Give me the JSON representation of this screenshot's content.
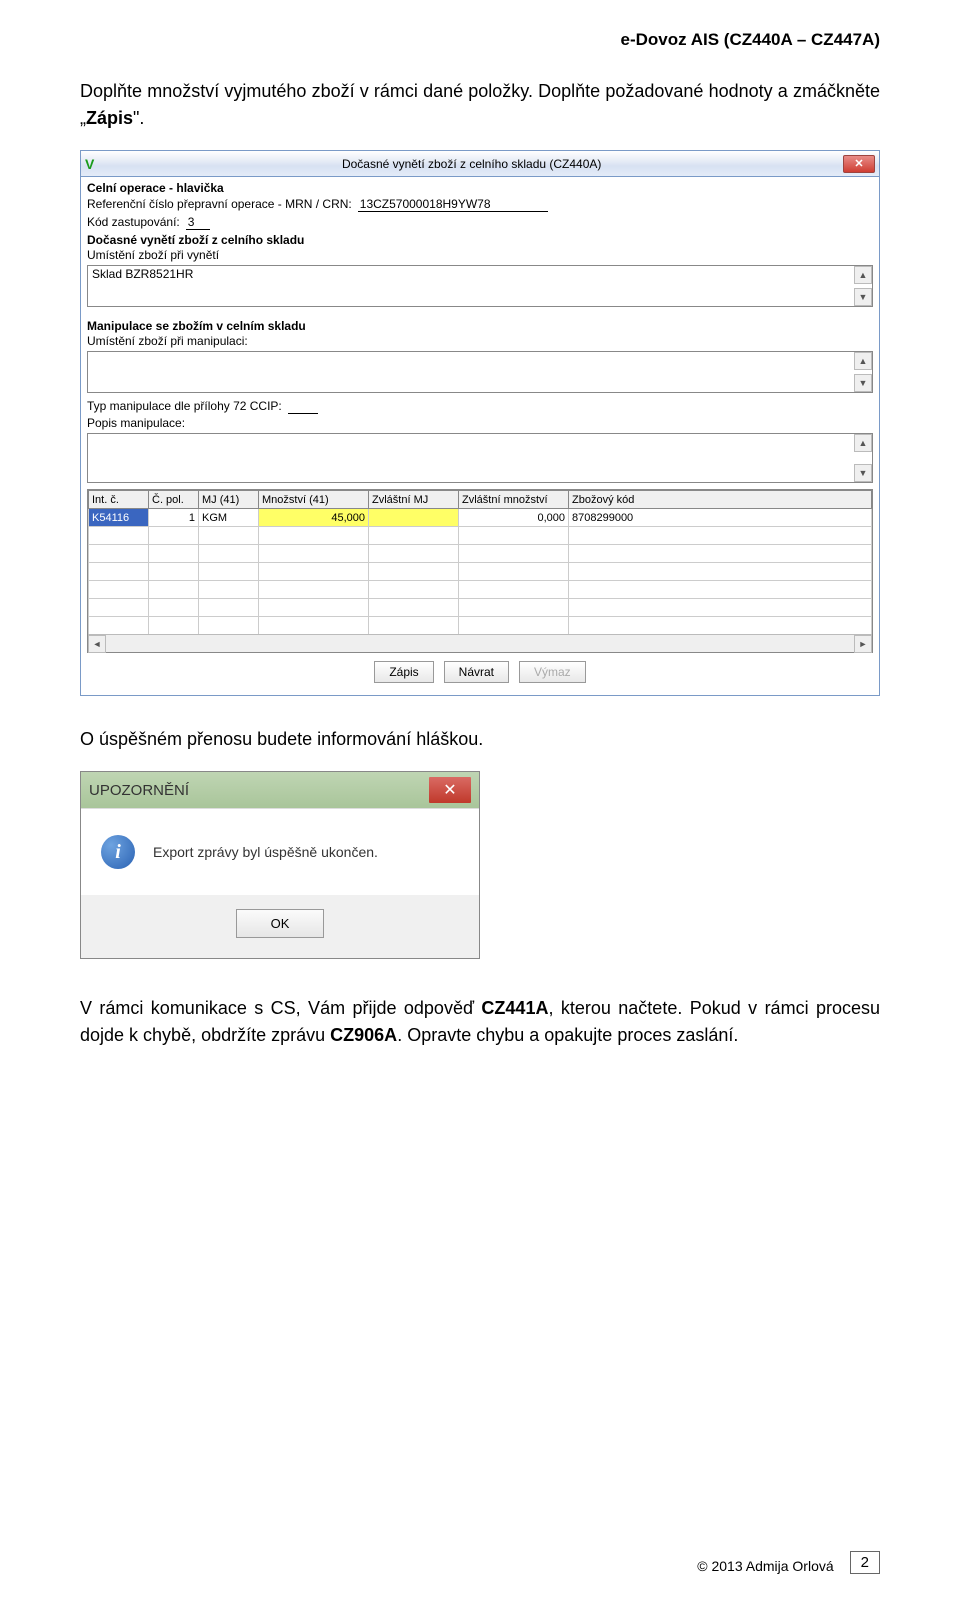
{
  "doc": {
    "header": "e-Dovoz AIS (CZ440A – CZ447A)",
    "para1a": "Doplňte množství vyjmutého zboží v rámci dané položky. Doplňte požadované hodnoty a zmáčkněte „",
    "para1b": "Zápis",
    "para1c": "\".",
    "para2": "O úspěšném přenosu budete informování hláškou.",
    "para3a": "V rámci komunikace s CS, Vám přijde odpověď ",
    "para3b": "CZ441A",
    "para3c": ", kterou načtete. Pokud v rámci procesu dojde k chybě, obdržíte zprávu ",
    "para3d": "CZ906A",
    "para3e": ". Opravte chybu a opakujte proces zaslání.",
    "copyright": "© 2013 Admija Orlová",
    "page": "2"
  },
  "win1": {
    "title": "Dočasné vynětí zboží z celního skladu (CZ440A)",
    "sec1": "Celní operace - hlavička",
    "lbl_mrn": "Referenční číslo přepravní operace - MRN / CRN:",
    "val_mrn": "13CZ57000018H9YW78",
    "lbl_kod": "Kód zastupování:",
    "val_kod": "3",
    "sec2": "Dočasné vynětí zboží z celního skladu",
    "lbl_umist1": "Umístění zboží při vynětí",
    "list1_item": "Sklad BZR8521HR",
    "sec3": "Manipulace se zbožím v celním skladu",
    "lbl_umist2": "Umístění zboží při manipulaci:",
    "lbl_typ": "Typ manipulace dle přílohy 72 CCIP:",
    "lbl_popis": "Popis manipulace:",
    "grid": {
      "headers": [
        "Int. č.",
        "Č. pol.",
        "MJ (41)",
        "Množství (41)",
        "Zvláštní MJ",
        "Zvláštní množství",
        "Zbožový kód"
      ],
      "row1": {
        "intc": "K54116",
        "cpol": "1",
        "mj": "KGM",
        "mnoz": "45,000",
        "zmj": "",
        "zmn": "0,000",
        "kod": "8708299000"
      }
    },
    "btn_zapis": "Zápis",
    "btn_navrat": "Návrat",
    "btn_vymaz": "Výmaz"
  },
  "msgbox": {
    "title": "UPOZORNĚNÍ",
    "text": "Export zprávy byl úspěšně ukončen.",
    "ok": "OK"
  }
}
